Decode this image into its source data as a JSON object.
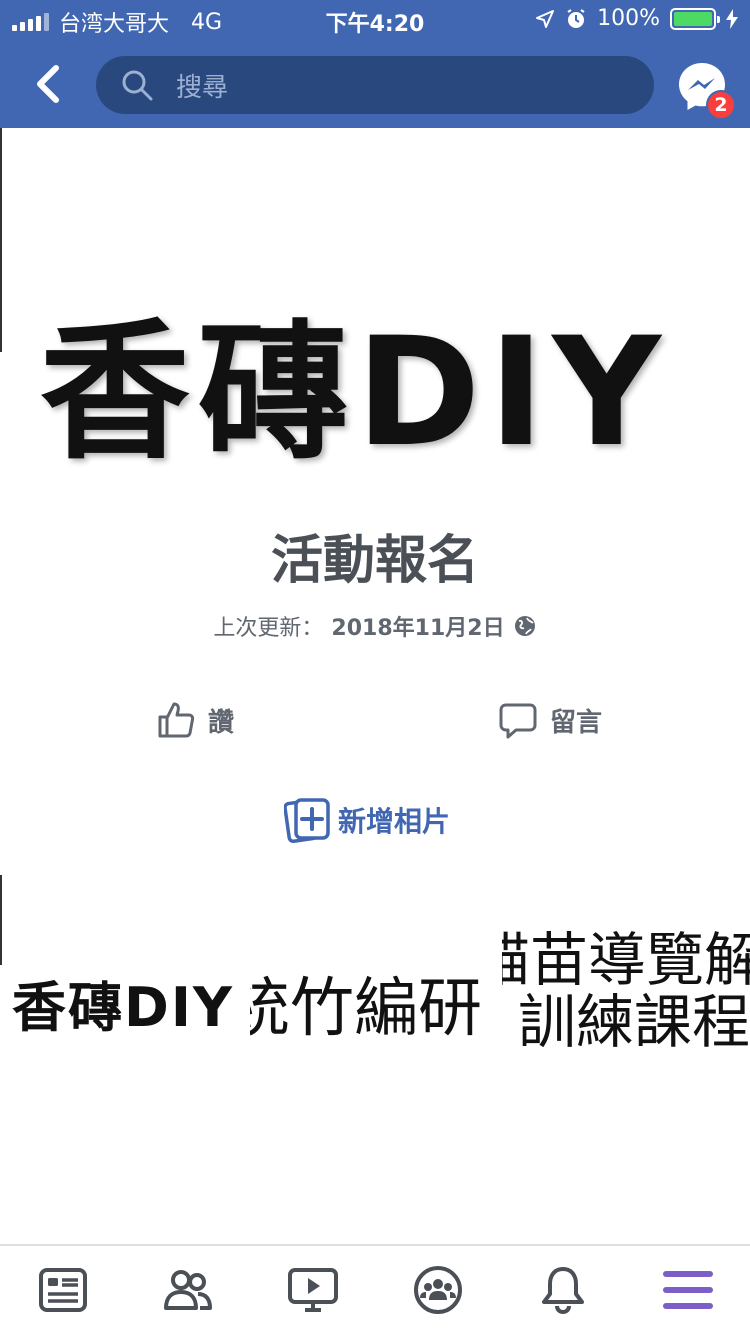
{
  "status_bar": {
    "carrier": "台湾大哥大",
    "network": "4G",
    "time": "下午4:20",
    "battery_percent": "100%"
  },
  "nav": {
    "search_placeholder": "搜尋",
    "messenger_badge": "2"
  },
  "album": {
    "cover_logo": "香磚DIY",
    "title": "活動報名",
    "updated_label": "上次更新：",
    "updated_date": "2018年11月2日",
    "privacy_icon": "globe-icon"
  },
  "actions": {
    "like_label": "讚",
    "comment_label": "留言",
    "add_photo_label": "新增相片"
  },
  "thumbnails": [
    {
      "text": "香磚DIY"
    },
    {
      "text": "統竹編研"
    },
    {
      "line1": "貓苗導覽解說",
      "line2": "訓練課程"
    }
  ],
  "tabs": [
    "news-feed-icon",
    "friends-icon",
    "watch-icon",
    "groups-icon",
    "notifications-icon",
    "menu-icon"
  ],
  "colors": {
    "brand": "#4267b2",
    "search_bg": "#29487d",
    "badge": "#fa3e3e",
    "active_tab": "#7b5fc7"
  }
}
